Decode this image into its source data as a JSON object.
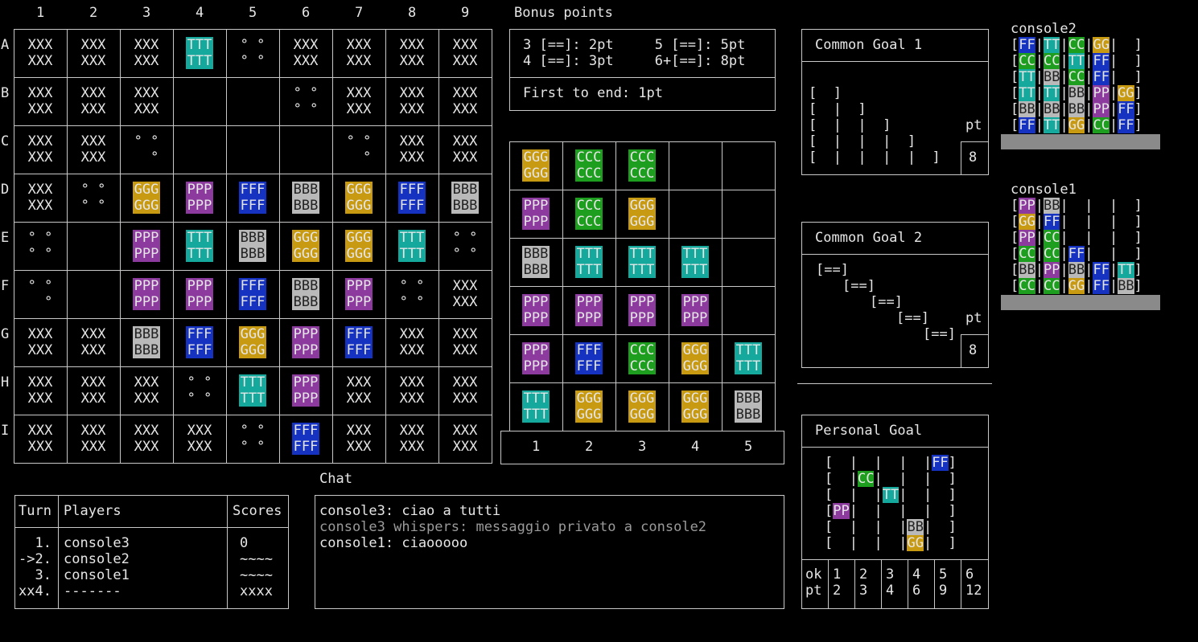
{
  "board": {
    "col_labels": [
      "1",
      "2",
      "3",
      "4",
      "5",
      "6",
      "7",
      "8",
      "9"
    ],
    "row_labels": [
      "A",
      "B",
      "C",
      "D",
      "E",
      "F",
      "G",
      "H",
      "I"
    ],
    "rows": [
      [
        "X",
        "X",
        "X",
        "T",
        "d4",
        "X",
        "X",
        "X",
        "X"
      ],
      [
        "X",
        "X",
        "X",
        "",
        "",
        "d4",
        "X",
        "X",
        "X"
      ],
      [
        "X",
        "X",
        "d3",
        "",
        "",
        "",
        "d3",
        "X",
        "X"
      ],
      [
        "X",
        "d4",
        "G",
        "P",
        "F",
        "B",
        "G",
        "F",
        "B"
      ],
      [
        "d4",
        "",
        "P",
        "T",
        "B",
        "G",
        "G",
        "T",
        "d4"
      ],
      [
        "d3",
        "",
        "P",
        "P",
        "F",
        "B",
        "P",
        "d4",
        "X"
      ],
      [
        "X",
        "X",
        "B",
        "F",
        "G",
        "P",
        "F",
        "X",
        "X"
      ],
      [
        "X",
        "X",
        "X",
        "d4",
        "T",
        "P",
        "X",
        "X",
        "X"
      ],
      [
        "X",
        "X",
        "X",
        "X",
        "d4",
        "F",
        "X",
        "X",
        "X"
      ]
    ]
  },
  "tile_text": {
    "X": "XXX",
    "G": "GGG",
    "C": "CCC",
    "P": "PPP",
    "F": "FFF",
    "B": "BBB",
    "T": "TTT"
  },
  "bonus": {
    "title": "Bonus points",
    "line1": "3 [==]: 2pt     5 [==]: 5pt",
    "line2": "4 [==]: 3pt     6+[==]: 8pt",
    "first": "First to end: 1pt"
  },
  "shelf": {
    "col_labels": [
      "1",
      "2",
      "3",
      "4",
      "5"
    ],
    "rows": [
      [
        "G",
        "C",
        "C",
        "",
        ""
      ],
      [
        "P",
        "C",
        "G",
        "",
        ""
      ],
      [
        "B",
        "T",
        "T",
        "T",
        ""
      ],
      [
        "P",
        "P",
        "P",
        "P",
        ""
      ],
      [
        "P",
        "F",
        "C",
        "G",
        "T"
      ],
      [
        "T",
        "G",
        "G",
        "G",
        "B"
      ]
    ]
  },
  "goal1": {
    "title": "Common Goal 1",
    "lines": [
      "[  ]",
      "[  |  ]",
      "[  |  |  ]",
      "[  |  |  |  ]",
      "[  |  |  |  |  ]"
    ],
    "pt_label": "pt",
    "pt_value": "8"
  },
  "goal2": {
    "title": "Common Goal 2",
    "lines": [
      "[==]",
      "[==]",
      "[==]",
      "[==]",
      "[==]"
    ],
    "pt_label": "pt",
    "pt_value": "8"
  },
  "personal": {
    "title": "Personal Goal",
    "rows": [
      [
        "",
        "",
        "",
        "",
        "F"
      ],
      [
        "",
        "C",
        "",
        "",
        ""
      ],
      [
        "",
        "",
        "T",
        "",
        ""
      ],
      [
        "P",
        "",
        "",
        "",
        ""
      ],
      [
        "",
        "",
        "",
        "B",
        ""
      ],
      [
        "",
        "",
        "",
        "G",
        ""
      ]
    ],
    "ok_label": "ok",
    "pt_label": "pt",
    "counts": [
      "1",
      "2",
      "3",
      "4",
      "5",
      "6"
    ],
    "points": [
      "2",
      "3",
      "4",
      "6",
      "9",
      "12"
    ]
  },
  "players_shelves": [
    {
      "name": "console2",
      "rows": [
        [
          "F",
          "T",
          "C",
          "G",
          ""
        ],
        [
          "C",
          "C",
          "T",
          "F",
          ""
        ],
        [
          "T",
          "B",
          "C",
          "F",
          ""
        ],
        [
          "T",
          "T",
          "B",
          "P",
          "G"
        ],
        [
          "B",
          "B",
          "B",
          "P",
          "F"
        ],
        [
          "F",
          "T",
          "G",
          "C",
          "F"
        ]
      ]
    },
    {
      "name": "console1",
      "rows": [
        [
          "P",
          "B",
          "",
          "",
          ""
        ],
        [
          "G",
          "F",
          "",
          "",
          ""
        ],
        [
          "P",
          "C",
          "",
          "",
          ""
        ],
        [
          "C",
          "C",
          "F",
          "",
          ""
        ],
        [
          "B",
          "P",
          "B",
          "F",
          "T"
        ],
        [
          "C",
          "C",
          "G",
          "F",
          "B"
        ]
      ]
    }
  ],
  "mini_text": {
    "F": "FF",
    "T": "TT",
    "C": "CC",
    "G": "GG",
    "B": "BB",
    "P": "PP"
  },
  "scoreboard": {
    "turn_header": "Turn",
    "players_header": "Players",
    "scores_header": "Scores",
    "rows": [
      {
        "turn": "  1.",
        "player": "console3",
        "score": "0"
      },
      {
        "turn": "->2.",
        "player": "console2",
        "score": "~~~~"
      },
      {
        "turn": "  3.",
        "player": "console1",
        "score": "~~~~"
      },
      {
        "turn": "xx4.",
        "player": "-------",
        "score": "xxxx"
      }
    ]
  },
  "chat": {
    "title": "Chat",
    "messages": [
      {
        "text": "console3: ciao a tutti",
        "whisper": false
      },
      {
        "text": "console3 whispers: messaggio privato a console2",
        "whisper": true
      },
      {
        "text": "console1: ciaooooo",
        "whisper": false
      }
    ]
  },
  "colors": {
    "T": "#15a89c",
    "G": "#c89a12",
    "C": "#1e9e1e",
    "P": "#8c3a9e",
    "F": "#1533c0",
    "B": "#b9b9b9"
  }
}
